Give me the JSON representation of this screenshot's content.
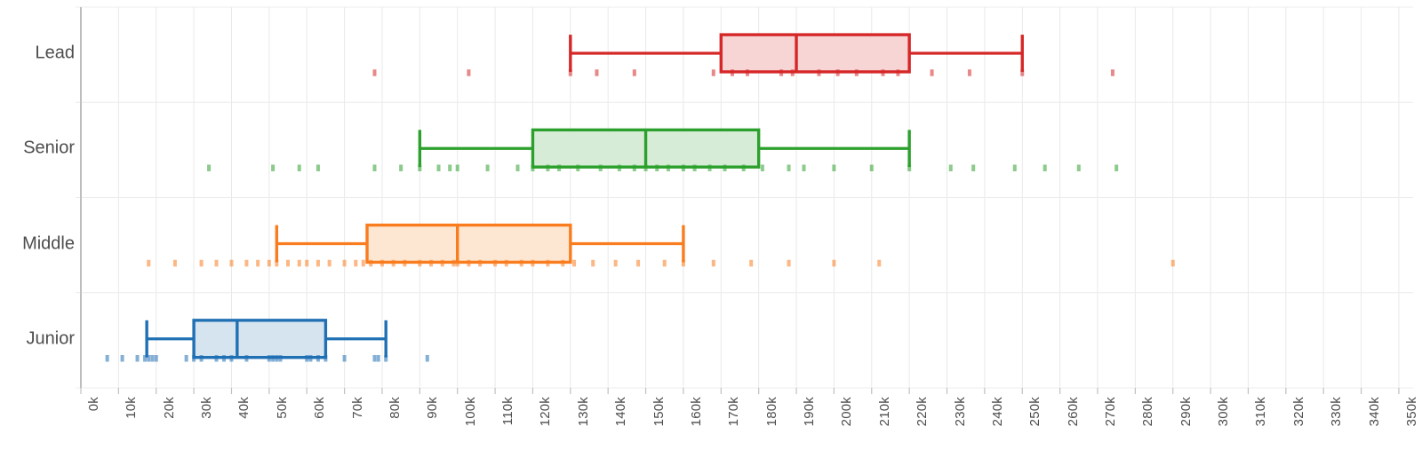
{
  "chart_data": {
    "type": "box",
    "orientation": "horizontal",
    "title": "",
    "xlabel": "",
    "ylabel": "",
    "xlim": [
      0,
      350000
    ],
    "xticks": [
      "0k",
      "10k",
      "20k",
      "30k",
      "40k",
      "50k",
      "60k",
      "70k",
      "80k",
      "90k",
      "100k",
      "110k",
      "120k",
      "130k",
      "140k",
      "150k",
      "160k",
      "170k",
      "180k",
      "190k",
      "200k",
      "210k",
      "220k",
      "230k",
      "240k",
      "250k",
      "260k",
      "270k",
      "280k",
      "290k",
      "300k",
      "310k",
      "320k",
      "330k",
      "340k",
      "350k"
    ],
    "xtick_values": [
      0,
      10000,
      20000,
      30000,
      40000,
      50000,
      60000,
      70000,
      80000,
      90000,
      100000,
      110000,
      120000,
      130000,
      140000,
      150000,
      160000,
      170000,
      180000,
      190000,
      200000,
      210000,
      220000,
      230000,
      240000,
      250000,
      260000,
      270000,
      280000,
      290000,
      300000,
      310000,
      320000,
      330000,
      340000,
      350000
    ],
    "categories": [
      "Lead",
      "Senior",
      "Middle",
      "Junior"
    ],
    "grid": {
      "vertical": true,
      "horizontal": true,
      "color": "#e8e8e8"
    },
    "legend": "none",
    "boxes": [
      {
        "category": "Lead",
        "color": "#d62728",
        "fill": "#f7d5d5",
        "whisker_low": 130000,
        "q1": 170000,
        "median": 190000,
        "q3": 220000,
        "whisker_high": 250000,
        "points": [
          78000,
          103000,
          130000,
          137000,
          147000,
          168000,
          173000,
          177000,
          186000,
          189000,
          196000,
          201000,
          206000,
          213000,
          217000,
          226000,
          236000,
          250000,
          274000
        ]
      },
      {
        "category": "Senior",
        "color": "#2ca02c",
        "fill": "#d6ecd6",
        "whisker_low": 90000,
        "q1": 120000,
        "median": 150000,
        "q3": 180000,
        "whisker_high": 220000,
        "points": [
          34000,
          51000,
          58000,
          63000,
          78000,
          85000,
          90000,
          95000,
          98000,
          100000,
          108000,
          116000,
          120000,
          124000,
          127000,
          132000,
          138000,
          143000,
          147000,
          150000,
          153000,
          156000,
          160000,
          163000,
          167000,
          171000,
          176000,
          181000,
          188000,
          192000,
          200000,
          210000,
          220000,
          231000,
          237000,
          248000,
          256000,
          265000,
          275000
        ]
      },
      {
        "category": "Middle",
        "color": "#f97c1f",
        "fill": "#fde7d2",
        "whisker_low": 52000,
        "q1": 76000,
        "median": 100000,
        "q3": 130000,
        "whisker_high": 160000,
        "points": [
          18000,
          25000,
          32000,
          36000,
          40000,
          44000,
          47000,
          50000,
          52000,
          55000,
          58000,
          60000,
          63000,
          66000,
          70000,
          73000,
          75000,
          77000,
          80000,
          83000,
          86000,
          90000,
          93000,
          96000,
          99000,
          100000,
          103000,
          106000,
          110000,
          113000,
          117000,
          120000,
          124000,
          128000,
          131000,
          136000,
          142000,
          148000,
          155000,
          160000,
          168000,
          178000,
          188000,
          200000,
          212000,
          290000
        ]
      },
      {
        "category": "Junior",
        "color": "#2070b4",
        "fill": "#d6e4f0",
        "whisker_low": 17500,
        "q1": 30000,
        "median": 41500,
        "q3": 65000,
        "whisker_high": 81000,
        "points": [
          7000,
          11000,
          15000,
          17000,
          18000,
          19000,
          20000,
          28000,
          30000,
          32000,
          36000,
          38000,
          40000,
          44000,
          50000,
          51000,
          52000,
          53000,
          60000,
          61000,
          63000,
          65000,
          70000,
          78000,
          79000,
          81000,
          92000
        ]
      }
    ]
  },
  "axis": {
    "category_labels": [
      "Lead",
      "Senior",
      "Middle",
      "Junior"
    ]
  }
}
